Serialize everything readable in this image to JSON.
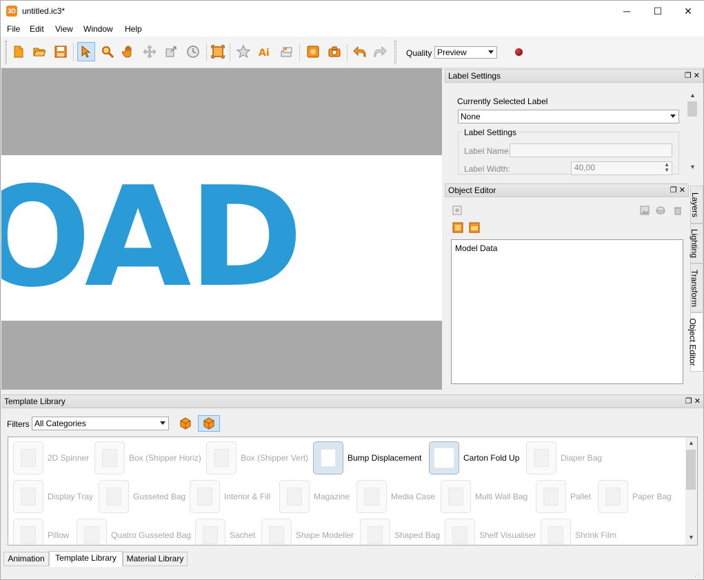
{
  "window": {
    "title": "untitled.ic3*",
    "app_icon_text": "3D",
    "minimize": "─",
    "maximize": "☐",
    "close": "✕"
  },
  "menu": [
    "File",
    "Edit",
    "View",
    "Window",
    "Help"
  ],
  "toolbar": {
    "quality_label": "Quality",
    "quality_value": "Preview"
  },
  "label_settings": {
    "title": "Label Settings",
    "currently_selected_label": "Currently Selected Label",
    "selected_value": "None",
    "group_title": "Label Settings",
    "label_name": "Label Name:",
    "label_name_value": "",
    "label_width": "Label Width:",
    "label_width_value": "40,00"
  },
  "object_editor": {
    "title": "Object Editor",
    "tree_root": "Model Data"
  },
  "side_tabs": [
    "Layers",
    "Lighting",
    "Transform",
    "Object Editor"
  ],
  "viewport": {
    "label_text": "OAD"
  },
  "template_library": {
    "title": "Template Library",
    "filters_label": "Filters",
    "category": "All Categories",
    "items": [
      {
        "label": "2D Spinner",
        "enabled": false
      },
      {
        "label": "Box (Shipper Horiz)",
        "enabled": false
      },
      {
        "label": "Box (Shipper Vert)",
        "enabled": false
      },
      {
        "label": "Bump Displacement",
        "enabled": true
      },
      {
        "label": "Carton Fold Up",
        "enabled": true
      },
      {
        "label": "Diaper Bag",
        "enabled": false
      },
      {
        "label": "Display Tray",
        "enabled": false
      },
      {
        "label": "Gusseted Bag",
        "enabled": false
      },
      {
        "label": "Interior & Fill",
        "enabled": false
      },
      {
        "label": "Magazine",
        "enabled": false
      },
      {
        "label": "Media Case",
        "enabled": false
      },
      {
        "label": "Multi Wall Bag",
        "enabled": false
      },
      {
        "label": "Pallet",
        "enabled": false
      },
      {
        "label": "Paper Bag",
        "enabled": false
      },
      {
        "label": "Pillow",
        "enabled": false
      },
      {
        "label": "Quatro Gusseted Bag",
        "enabled": false
      },
      {
        "label": "Sachet",
        "enabled": false
      },
      {
        "label": "Shape Modeller",
        "enabled": false
      },
      {
        "label": "Shaped Bag",
        "enabled": false
      },
      {
        "label": "Shelf Visualiser",
        "enabled": false
      },
      {
        "label": "Shrink Film",
        "enabled": false
      }
    ]
  },
  "bottom_tabs": [
    "Animation",
    "Template Library",
    "Material Library"
  ],
  "colors": {
    "accent": "#f08a24",
    "label_blue": "#2a9bd6",
    "viewport_gray": "#a9a9a9"
  }
}
